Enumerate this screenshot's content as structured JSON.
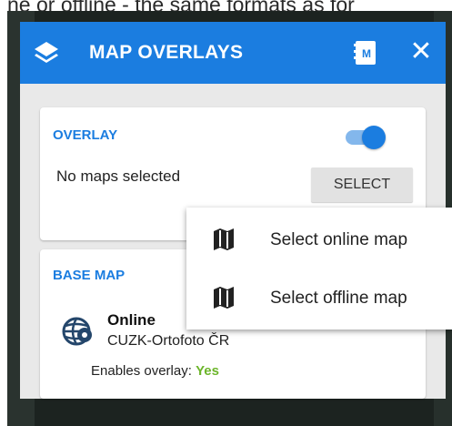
{
  "top_text": "ne or offline - the same formats as for",
  "header": {
    "title": "MAP OVERLAYS",
    "mapbook_icon": "M",
    "close_glyph": "✕"
  },
  "overlay_section": {
    "label": "OVERLAY",
    "toggle_on": true,
    "status_text": "No maps selected",
    "select_button": "SELECT"
  },
  "popup_menu": {
    "items": [
      {
        "label": "Select online map",
        "icon": "map-icon"
      },
      {
        "label": "Select offline map",
        "icon": "map-icon"
      }
    ]
  },
  "base_map_section": {
    "label": "BASE MAP",
    "type": "Online",
    "name": "CUZK-Ortofoto ČR",
    "enables_label": "Enables overlay:",
    "enables_value": "Yes"
  },
  "colors": {
    "accent": "#1b7de0",
    "yes_green": "#6cb52a"
  }
}
